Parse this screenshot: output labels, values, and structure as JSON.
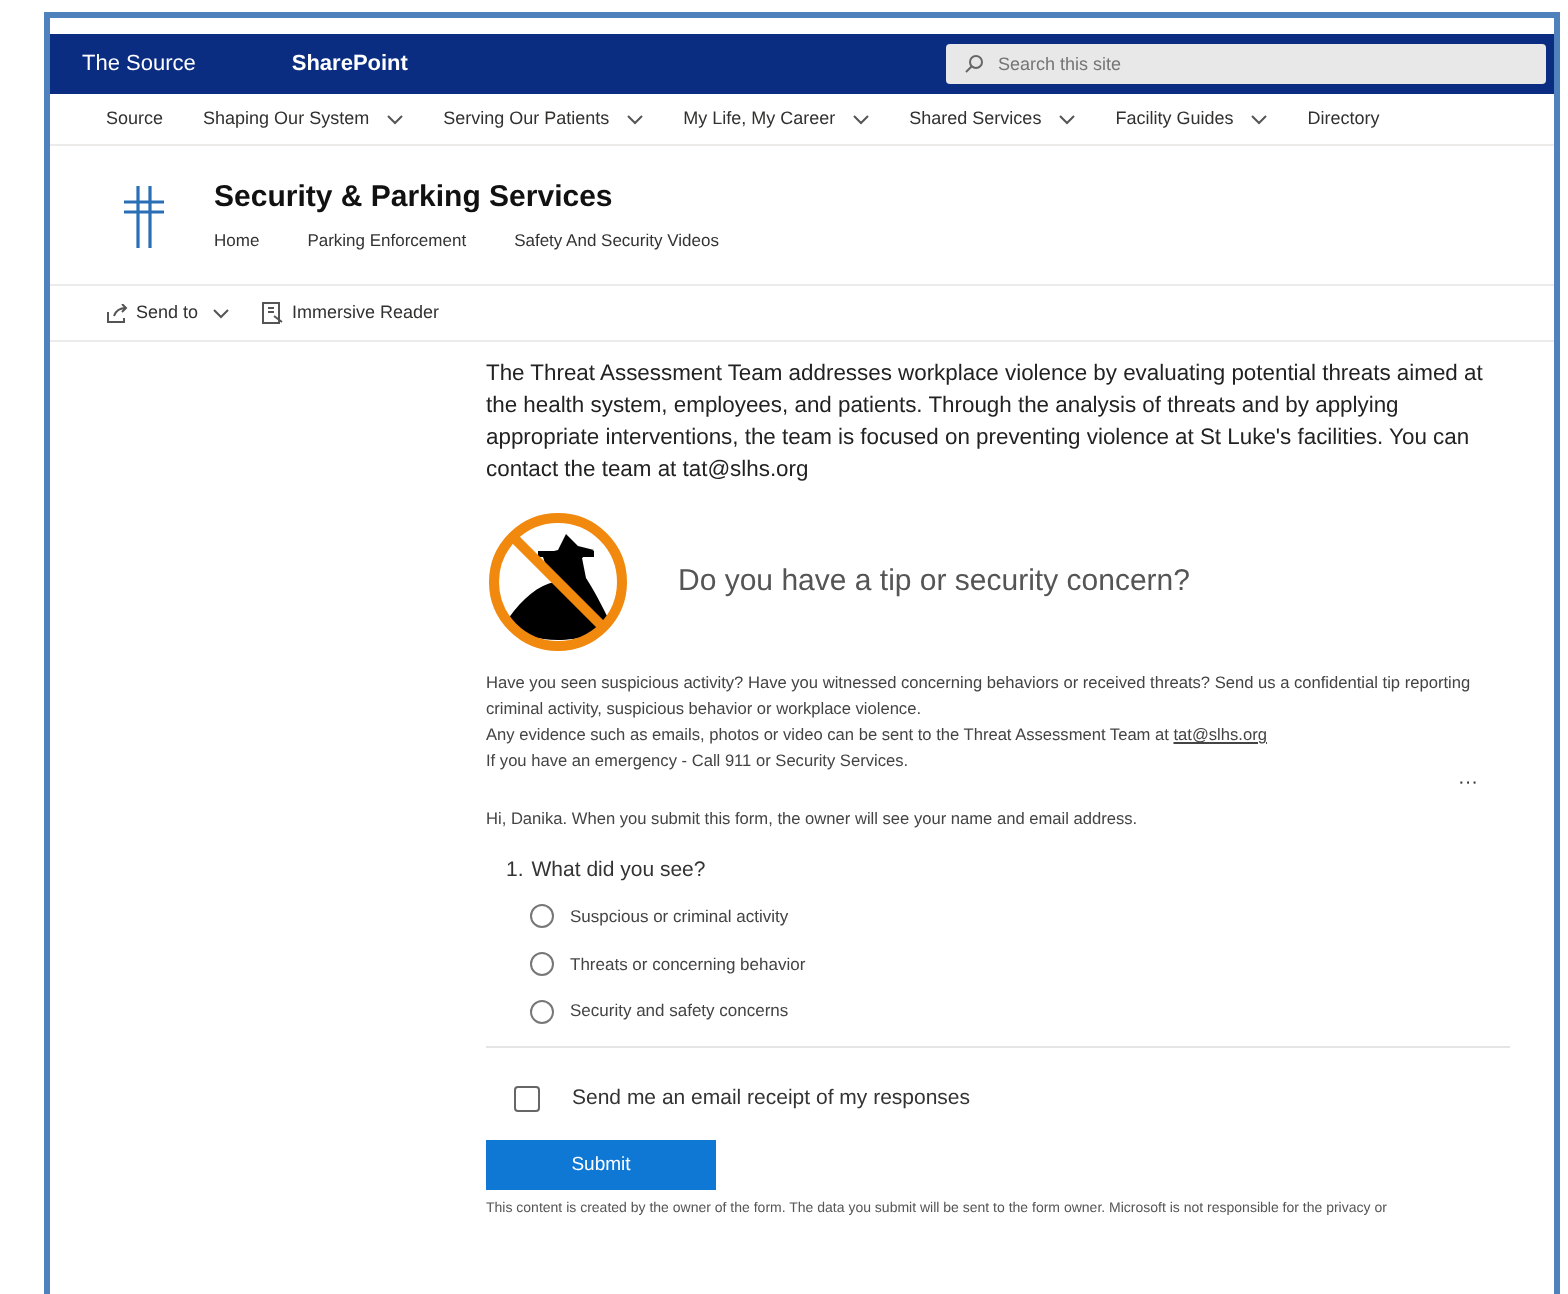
{
  "suite_bar": {
    "source_link": "The Source",
    "app_name": "SharePoint",
    "search": {
      "placeholder": "Search this site"
    }
  },
  "hub_nav": [
    {
      "label": "Source",
      "has_menu": false
    },
    {
      "label": "Shaping Our System",
      "has_menu": true
    },
    {
      "label": "Serving Our Patients",
      "has_menu": true
    },
    {
      "label": "My Life, My Career",
      "has_menu": true
    },
    {
      "label": "Shared Services",
      "has_menu": true
    },
    {
      "label": "Facility Guides",
      "has_menu": true
    },
    {
      "label": "Directory",
      "has_menu": false
    }
  ],
  "site": {
    "title": "Security & Parking Services",
    "nav": [
      "Home",
      "Parking Enforcement",
      "Safety And Security Videos"
    ]
  },
  "command_bar": [
    {
      "kind": "send",
      "label": "Send to"
    },
    {
      "kind": "reader",
      "label": "Immersive Reader"
    }
  ],
  "intro": "The Threat Assessment Team addresses workplace violence by evaluating potential threats aimed at the health system, employees, and patients. Through the analysis of threats and by applying appropriate interventions, the team is focused on preventing violence at St Luke's facilities. You can contact the team at tat@slhs.org",
  "form": {
    "heading": "Do you have a tip or security concern?",
    "description": [
      "Have you seen suspicious activity? Have you witnessed concerning behaviors or received threats? Send us a confidential tip reporting criminal activity, suspicious behavior or workplace violence."
    ],
    "evidence": {
      "text": "Any evidence such as emails, photos or video can be sent to the Threat Assessment Team at",
      "link": "tat@slhs.org"
    },
    "emergency": "If you have an emergency - Call 911 or Security Services.",
    "more": "···",
    "notice": "Hi, Danika. When you submit this form, the owner will see your name and email address.",
    "question": {
      "number": "1.",
      "text": "What did you see?",
      "options": [
        {
          "label": "Suspcious or criminal activity",
          "selected": false
        },
        {
          "label": "Threats or concerning behavior",
          "selected": false
        },
        {
          "label": "Security and safety concerns",
          "selected": false
        }
      ]
    },
    "receipt": {
      "label": "Send me an email receipt of my responses",
      "checked": false
    },
    "submit": "Submit",
    "disclaimer": "This content is created by the owner of the form. The data you submit will be sent to the form owner. Microsoft is not responsible for the privacy or"
  }
}
